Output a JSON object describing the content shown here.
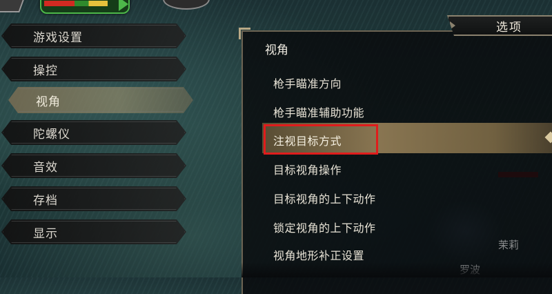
{
  "hud": {
    "health_bar": "health-bar"
  },
  "left_menu": {
    "items": [
      {
        "label": "游戏设置",
        "selected": false
      },
      {
        "label": "操控",
        "selected": false
      },
      {
        "label": "视角",
        "selected": true
      },
      {
        "label": "陀螺仪",
        "selected": false
      },
      {
        "label": "音效",
        "selected": false
      },
      {
        "label": "存档",
        "selected": false
      },
      {
        "label": "显示",
        "selected": false
      }
    ]
  },
  "panel": {
    "tab_title": "选项",
    "section_title": "视角",
    "options": [
      "枪手瞄准方向",
      "枪手瞄准辅助功能",
      "注视目标方式",
      "目标视角操作",
      "目标视角的上下动作",
      "锁定视角的上下动作",
      "视角地形补正设置"
    ],
    "highlighted_option": "注视目标方式"
  },
  "background_names": {
    "name1": "茉莉",
    "name2": "罗波"
  },
  "colors": {
    "highlight_frame": "#e01c1c",
    "selection_gold": "#968058"
  }
}
